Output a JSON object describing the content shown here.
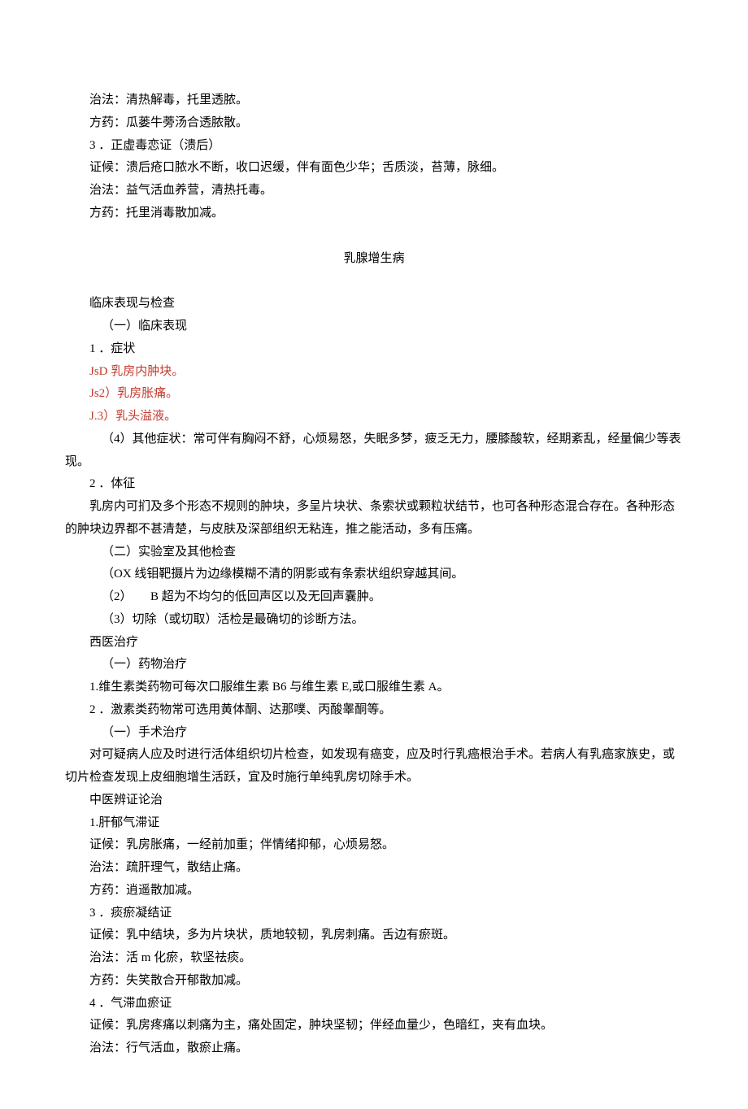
{
  "section1": {
    "l1": "治法：清热解毒，托里透脓。",
    "l2": "方药：瓜蒌牛蒡汤合透脓散。",
    "l3": "3 ．正虚毒恋证（溃后）",
    "l4": "证候：溃后疮口脓水不断，收口迟缓，伴有面色少华；舌质淡，苔薄，脉细。",
    "l5": "治法：益气活血养营，清热托毒。",
    "l6": "方药：托里消毒散加减。"
  },
  "title1": "乳腺增生病",
  "section2": {
    "l1": "临床表现与检查",
    "l2": "（一）临床表现",
    "l3": "1 ．症状",
    "l4": "JsD 乳房内肿块。",
    "l5": "Js2）乳房胀痛。",
    "l6": "J.3）乳头溢液。",
    "l7": "（4）其他症状：常可伴有胸闷不舒，心烦易怒，失眠多梦，疲乏无力，腰膝酸软，经期紊乱，经量偏少等表现。",
    "l8": "2 ．体征",
    "l9": "乳房内可扪及多个形态不规则的肿块，多呈片块状、条索状或颗粒状结节，也可各种形态混合存在。各种形态的肿块边界都不甚清楚，与皮肤及深部组织无粘连，推之能活动，多有压痛。",
    "l10": "（二）实验室及其他检查",
    "l11": "（OX 线钼靶摄片为边缘模糊不清的阴影或有条索状组织穿越其间。",
    "l12": "（2）　　B 超为不均匀的低回声区以及无回声囊肿。",
    "l13": "（3）切除（或切取）活检是最确切的诊断方法。",
    "l14": "西医治疗",
    "l15": "（一）药物治疗",
    "l16": "1.维生素类药物可每次口服维生素 B6 与维生素 E,或口服维生素 A。",
    "l17": "2 ．激素类药物常可选用黄体酮、达那噗、丙酸睾酮等。",
    "l18": "（一）手术治疗",
    "l19": "对可疑病人应及时进行活体组织切片检查，如发现有癌变，应及时行乳癌根治手术。若病人有乳癌家族史，或切片检查发现上皮细胞增生活跃，宜及时施行单纯乳房切除手术。",
    "l20": "中医辨证论治",
    "l21": "1.肝郁气滞证",
    "l22": "证候：乳房胀痛，一经前加重；伴情绪抑郁，心烦易怒。",
    "l23": "治法：疏肝理气，散结止痛。",
    "l24": "方药：逍遥散加减。",
    "l25": "3 ．痰瘀凝结证",
    "l26": "证候：乳中结块，多为片块状，质地较韧，乳房刺痛。舌边有瘀斑。",
    "l27": "治法：活 m 化瘀，软坚祛痰。",
    "l28": "方药：失笑散合开郁散加减。",
    "l29": "4 ．气滞血瘀证",
    "l30": "证候：乳房疼痛以刺痛为主，痛处固定，肿块坚韧；伴经血量少，色暗红，夹有血块。",
    "l31": "治法：行气活血，散瘀止痛。"
  }
}
